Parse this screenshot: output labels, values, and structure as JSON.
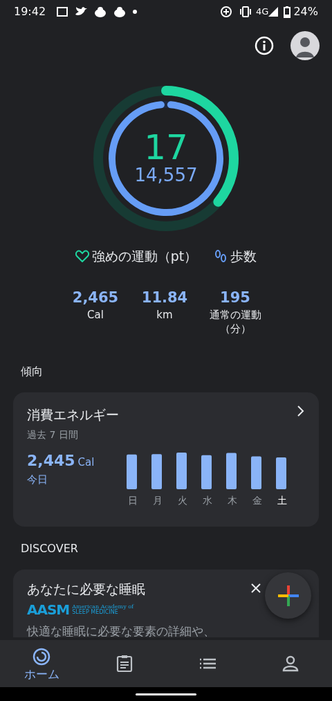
{
  "status_bar": {
    "time": "19:42",
    "network": "4G",
    "battery": "24%"
  },
  "rings": {
    "heart": {
      "value": "17",
      "level": 0.36
    },
    "steps": {
      "value": "14,557",
      "level": 1.0
    }
  },
  "legend": [
    {
      "kind": "heart",
      "label": "強めの運動（pt）"
    },
    {
      "kind": "steps",
      "label": "歩数"
    }
  ],
  "stats": [
    {
      "value": "2,465",
      "label": "Cal"
    },
    {
      "value": "11.84",
      "label": "km"
    },
    {
      "value": "195",
      "label": "通常の運動（分）"
    }
  ],
  "trends_title": "傾向",
  "energy_card": {
    "title": "消費エネルギー",
    "subtitle": "過去 7 日間",
    "value": "2,445",
    "unit": "Cal",
    "caption": "今日",
    "days": [
      {
        "label": "日",
        "selected": false
      },
      {
        "label": "月",
        "selected": false
      },
      {
        "label": "火",
        "selected": false
      },
      {
        "label": "水",
        "selected": false
      },
      {
        "label": "木",
        "selected": false
      },
      {
        "label": "金",
        "selected": false
      },
      {
        "label": "土",
        "selected": true
      }
    ]
  },
  "discover_title": "DISCOVER",
  "discover_card": {
    "title": "あなたに必要な睡眠",
    "brand": "AASM",
    "brand_line1": "American Academy of",
    "brand_line2": "SLEEP MEDICINE",
    "body": "快適な睡眠に必要な要素の詳細や、"
  },
  "nav": [
    {
      "kind": "home",
      "label": "ホーム",
      "selected": true
    },
    {
      "kind": "journal",
      "selected": false
    },
    {
      "kind": "browse",
      "selected": false
    },
    {
      "kind": "profile",
      "selected": false
    }
  ]
}
